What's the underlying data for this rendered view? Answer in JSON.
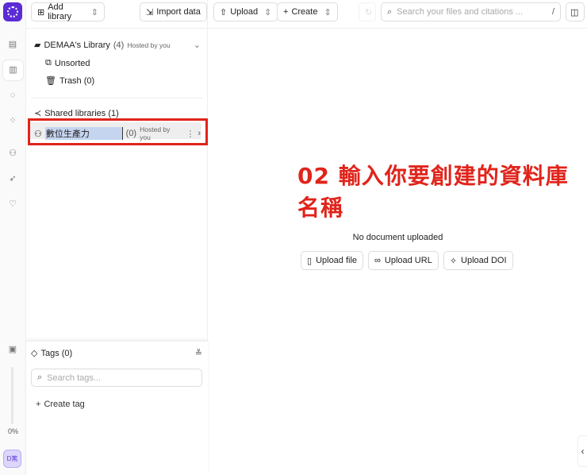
{
  "rail": {
    "usage_percent": "0%",
    "avatar": "D篤"
  },
  "sidebar": {
    "add_library": "Add library",
    "import_data": "Import data",
    "library": {
      "name": "DEMAA's Library",
      "count": "(4)",
      "hosted": "Hosted by you"
    },
    "unsorted": "Unsorted",
    "trash": "Trash (0)",
    "shared_title": "Shared libraries (1)",
    "shared_item": {
      "name": "數位生產力",
      "count": "(0)",
      "hosted": "Hosted by you"
    },
    "tags_title": "Tags (0)",
    "tags_placeholder": "Search tags...",
    "create_tag": "Create tag"
  },
  "toolbar": {
    "upload": "Upload",
    "create": "Create",
    "search_placeholder": "Search your files and citations ...",
    "search_shortcut": "/"
  },
  "main": {
    "empty": "No document uploaded",
    "upload_file": "Upload file",
    "upload_url": "Upload URL",
    "upload_doi": "Upload DOI"
  },
  "annotation": "02 輸入你要創建的資料庫名稱",
  "colors": {
    "accent": "#5b2bd6",
    "annotation": "#e0241b"
  }
}
